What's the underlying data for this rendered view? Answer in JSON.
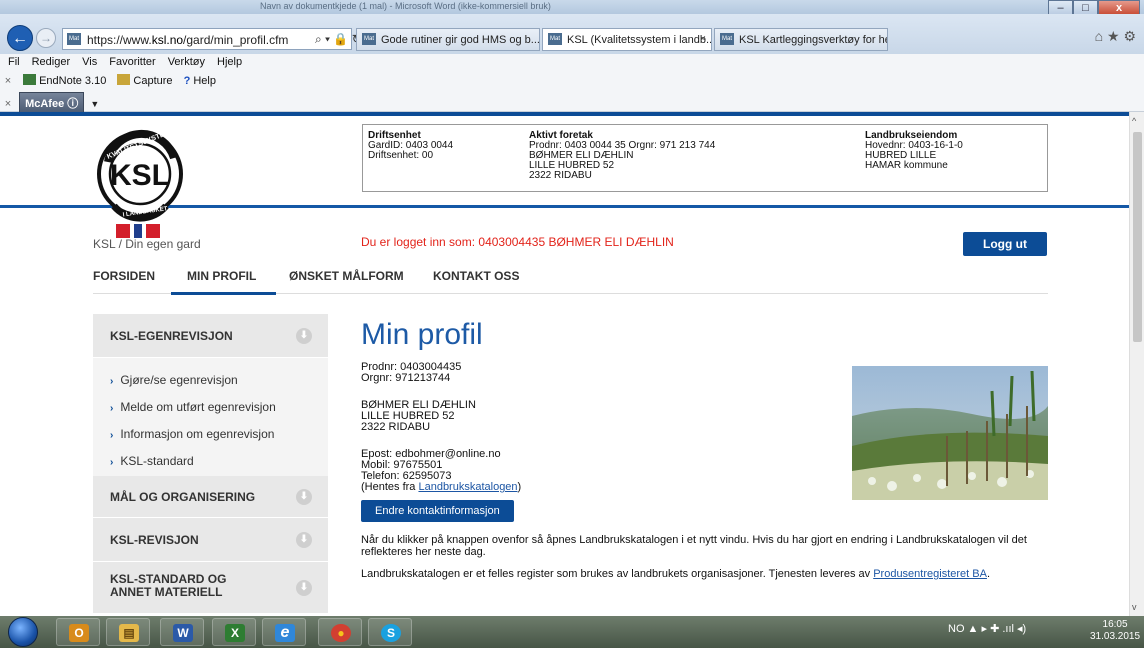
{
  "window": {
    "title": "Navn av dokumentkjede (1 mal) - Microsoft Word (ikke-kommersiell bruk)",
    "minimize": "–",
    "maximize": "□",
    "close": "x"
  },
  "browser": {
    "url_prefix": "https://www.",
    "url_domain": "ksl.no",
    "url_path": "/gard/min_profil.cfm",
    "addr_icons": "⌕ ▾ 🔒 ↻",
    "tabs": [
      {
        "label": "Gode rutiner gir god HMS og b...",
        "active": false
      },
      {
        "label": "KSL (Kvalitetssystem i landb...",
        "active": true
      },
      {
        "label": "KSL Kartleggingsverktøy for he...",
        "active": false
      }
    ],
    "tab_close": "×",
    "right_icons": "⌂ ★ ⚙",
    "favicon_text": "Mat"
  },
  "menubar": [
    "Fil",
    "Rediger",
    "Vis",
    "Favoritter",
    "Verktøy",
    "Hjelp"
  ],
  "toolbar": {
    "items": [
      "EndNote 3.10",
      "Capture",
      "Help"
    ],
    "mcafee": "McAfee",
    "x": "×"
  },
  "header": {
    "logo_top": "KVALITETSSYSTEM",
    "logo_center": "KSL",
    "logo_bottom": "I LANDBRUKET",
    "driftsenhet": {
      "heading": "Driftsenhet",
      "lines": [
        "GardID: 0403 0044",
        "Driftsenhet: 00"
      ]
    },
    "foretak": {
      "heading": "Aktivt foretak",
      "lines": [
        "Prodnr: 0403 0044 35 Orgnr: 971 213 744",
        "BØHMER ELI DÆHLIN",
        "LILLE HUBRED 52",
        "2322 RIDABU"
      ]
    },
    "eiendom": {
      "heading": "Landbrukseiendom",
      "lines": [
        "Hovednr: 0403-16-1-0",
        "HUBRED LILLE",
        "HAMAR kommune"
      ]
    },
    "breadcrumb": "KSL / Din egen gard",
    "logged_in": "Du er logget inn som: 0403004435 BØHMER ELI DÆHLIN",
    "logout": "Logg ut"
  },
  "nav": {
    "items": [
      "FORSIDEN",
      "MIN PROFIL",
      "ØNSKET MÅLFORM",
      "KONTAKT OSS"
    ],
    "active_index": 1
  },
  "sidebar": {
    "sections": [
      {
        "title": "KSL-EGENREVISJON",
        "links": [
          "Gjøre/se egenrevisjon",
          "Melde om utført egenrevisjon",
          "Informasjon om egenrevisjon",
          "KSL-standard"
        ]
      },
      {
        "title": "MÅL OG ORGANISERING"
      },
      {
        "title": "KSL-REVISJON"
      },
      {
        "title": "KSL-STANDARD OG",
        "title2": "ANNET MATERIELL"
      }
    ],
    "arrow": "⬇",
    "chev": "›"
  },
  "content": {
    "title": "Min profil",
    "prodnr": "Prodnr: 0403004435",
    "orgnr": "Orgnr: 971213744",
    "name": "BØHMER ELI DÆHLIN",
    "address1": "LILLE HUBRED 52",
    "address2": "2322 RIDABU",
    "email": "Epost: edbohmer@online.no",
    "mobile": "Mobil: 97675501",
    "phone": "Telefon: 62595073",
    "source_prefix": "(Hentes fra ",
    "source_link": "Landbrukskatalogen",
    "source_suffix": ")",
    "button": "Endre kontaktinformasjon",
    "para1": "Når du klikker på knappen ovenfor så åpnes Landbrukskatalogen i et nytt vindu. Hvis du har gjort en endring i Landbrukskatalogen vil det reflekteres her neste dag.",
    "para2_prefix": "Landbrukskatalogen er et felles register som brukes av landbrukets organisasjoner. Tjenesten leveres av ",
    "para2_link": "Produsentregisteret BA",
    "para2_suffix": "."
  },
  "taskbar": {
    "apps": [
      "outlook-icon",
      "explorer-icon",
      "word-icon",
      "excel-icon",
      "ie-icon",
      "chrome-icon",
      "skype-icon"
    ],
    "app_glyphs": [
      "O",
      "▤",
      "W",
      "X",
      "e",
      "●",
      "S"
    ],
    "tray": "NO  ▲  ▸  ✚  .ııl  ◂)",
    "time": "16:05",
    "date": "31.03.2015"
  }
}
